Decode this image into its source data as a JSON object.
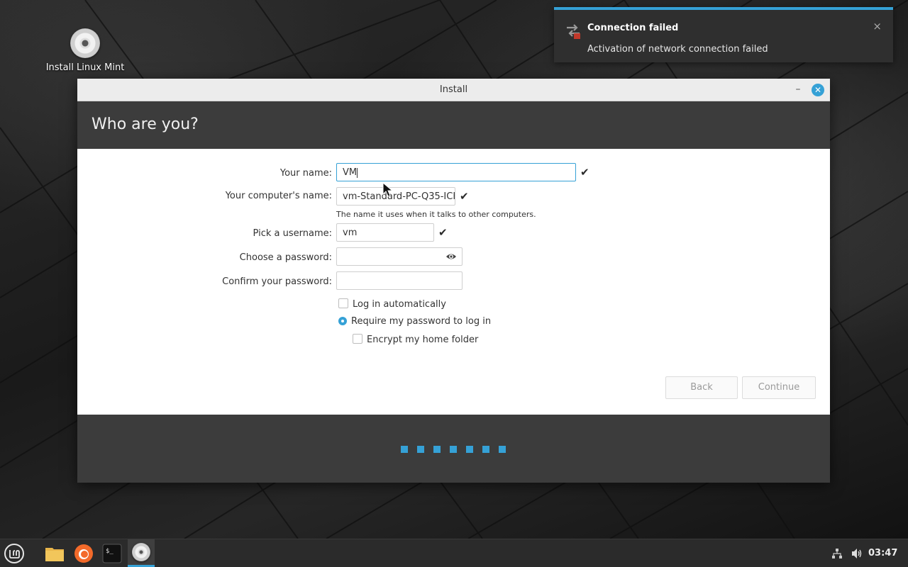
{
  "desktop": {
    "icon_label": "Install Linux Mint"
  },
  "notification": {
    "title": "Connection failed",
    "body": "Activation of network connection failed",
    "close_glyph": "×"
  },
  "window": {
    "title": "Install",
    "minimize_glyph": "–",
    "close_glyph": "✕",
    "heading": "Who are you?"
  },
  "form": {
    "name_label": "Your name:",
    "name_value": "VM",
    "computer_label": "Your computer's name:",
    "computer_value": "vm-Standard-PC-Q35-ICH",
    "computer_hint": "The name it uses when it talks to other computers.",
    "username_label": "Pick a username:",
    "username_value": "vm",
    "password_label": "Choose a password:",
    "password_value": "",
    "confirm_label": "Confirm your password:",
    "confirm_value": "",
    "check_glyph": "✔"
  },
  "options": {
    "login_auto": "Log in automatically",
    "login_auto_checked": false,
    "require_password": "Require my password to log in",
    "require_password_selected": true,
    "encrypt_home": "Encrypt my home folder",
    "encrypt_home_checked": false
  },
  "buttons": {
    "back": "Back",
    "continue": "Continue"
  },
  "progress": {
    "steps_completed": 7
  },
  "taskbar": {
    "clock": "03:47",
    "launchers": [
      "menu-icon",
      "files-icon",
      "firefox-icon",
      "terminal-icon",
      "installer-icon"
    ]
  },
  "colors": {
    "accent": "#35a1d6",
    "header_bg": "#3c3c3c",
    "notification_bg": "#2f2f2f"
  }
}
